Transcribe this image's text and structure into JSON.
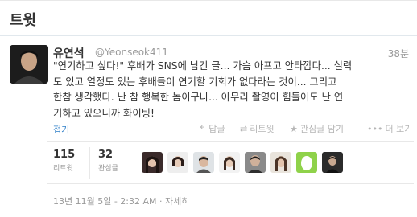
{
  "modal": {
    "title": "트윗"
  },
  "tweet": {
    "author_name": "유연석",
    "author_handle": "@Yeonseok411",
    "time": "38분",
    "text": "\"연기하고 싶다!\" 후배가 SNS에 남긴 글... 가슴 아프고 안타깝다... 실력\n도 있고 열정도 있는 후배들이 연기할 기회가 없다라는 것이... 그리고\n한참 생각했다. 난 참 행복한 놈이구나... 아무리 촬영이 힘들어도 난 연\n기하고 있으니까 화이팅!",
    "collapse_label": "접기"
  },
  "actions": {
    "reply": {
      "icon": "reply-icon",
      "label": "답글"
    },
    "retweet": {
      "icon": "retweet-icon",
      "label": "리트윗"
    },
    "favorite": {
      "icon": "star-icon",
      "label": "관심글 담기"
    },
    "more": {
      "icon": "more-icon",
      "label": "더 보기"
    }
  },
  "stats": {
    "retweets": {
      "count": "115",
      "label": "리트윗"
    },
    "favorites": {
      "count": "32",
      "label": "관심글"
    }
  },
  "meta": {
    "timestamp": "13년 11월 5일 - 2:32 AM",
    "separator": "·",
    "details_label": "자세히"
  },
  "colors": {
    "link": "#2a7cc7",
    "muted": "#999999",
    "border": "#e8e8e8"
  }
}
